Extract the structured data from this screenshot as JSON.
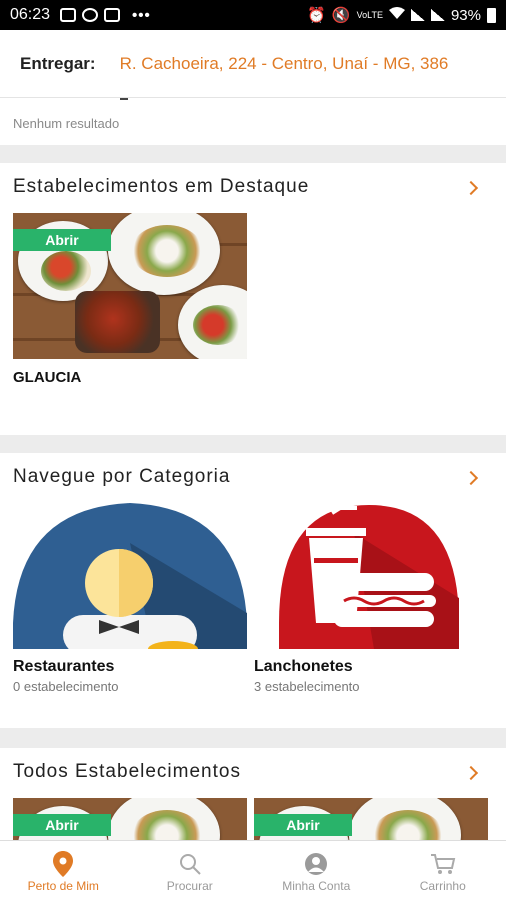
{
  "status_bar": {
    "time": "06:23",
    "battery": "93%",
    "dots": "•••",
    "net": "VoLTE"
  },
  "header": {
    "label": "Entregar:",
    "address": "R. Cachoeira, 224 - Centro, Unaí - MG, 386"
  },
  "search": {
    "no_result": "Nenhum resultado"
  },
  "featured": {
    "title": "Estabelecimentos em Destaque",
    "items": [
      {
        "badge": "Abrir",
        "name": "GLAUCIA"
      }
    ]
  },
  "categories": {
    "title": "Navegue por Categoria",
    "items": [
      {
        "name": "Restaurantes",
        "count": "0 estabelecimento",
        "icon": "waiter-icon"
      },
      {
        "name": "Lanchonetes",
        "count": "3 estabelecimento",
        "icon": "fast-food-icon"
      }
    ]
  },
  "all": {
    "title": "Todos Estabelecimentos",
    "items": [
      {
        "badge": "Abrir"
      },
      {
        "badge": "Abrir"
      }
    ]
  },
  "bottom_nav": {
    "items": [
      {
        "label": "Perto de Mim",
        "icon": "location-pin-icon",
        "active": true
      },
      {
        "label": "Procurar",
        "icon": "search-icon",
        "active": false
      },
      {
        "label": "Minha Conta",
        "icon": "user-icon",
        "active": false
      },
      {
        "label": "Carrinho",
        "icon": "cart-icon",
        "active": false
      }
    ]
  },
  "colors": {
    "accent": "#e07b26",
    "open_badge": "#29b36a",
    "restaurant_blue": "#2f5f92",
    "snack_red": "#c8161d"
  }
}
